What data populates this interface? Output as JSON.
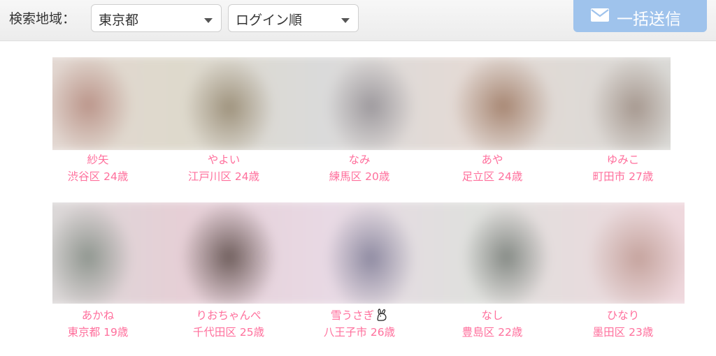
{
  "search": {
    "label": "検索地域：",
    "region": "東京都",
    "order": "ログイン順"
  },
  "send_all": {
    "label": "一括送信",
    "icon": "mail-icon",
    "color": "#9fc3ec"
  },
  "accent_color": "#ff6f9c",
  "rows": [
    {
      "photos": [
        {
          "tone": "#c7a79c"
        },
        {
          "tone": "#a39a87"
        },
        {
          "tone": "#9f9c9e"
        },
        {
          "tone": "#a88d7a"
        },
        {
          "tone": "#a79f98"
        }
      ],
      "members": [
        {
          "name": "紗矢",
          "meta": "渋谷区 24歳"
        },
        {
          "name": "やよい",
          "meta": "江戸川区 24歳"
        },
        {
          "name": "なみ",
          "meta": "練馬区 20歳"
        },
        {
          "name": "あや",
          "meta": "足立区 24歳"
        },
        {
          "name": "ゆみこ",
          "meta": "町田市 27歳"
        }
      ]
    },
    {
      "photos": [
        {
          "tone": "#9a9f9c"
        },
        {
          "tone": "#7f6f6d"
        },
        {
          "tone": "#9b97a7"
        },
        {
          "tone": "#8f928f"
        },
        {
          "tone": "#c8aaa6"
        }
      ],
      "members": [
        {
          "name": "あかね",
          "meta": "東京都 19歳"
        },
        {
          "name": "りおちゃんぺ",
          "meta": "千代田区 25歳"
        },
        {
          "name": "雪うさぎ",
          "meta": "八王子市 26歳",
          "icon": "rabbit-icon"
        },
        {
          "name": "なし",
          "meta": "豊島区 22歳"
        },
        {
          "name": "ひなり",
          "meta": "墨田区 23歳"
        }
      ]
    }
  ]
}
